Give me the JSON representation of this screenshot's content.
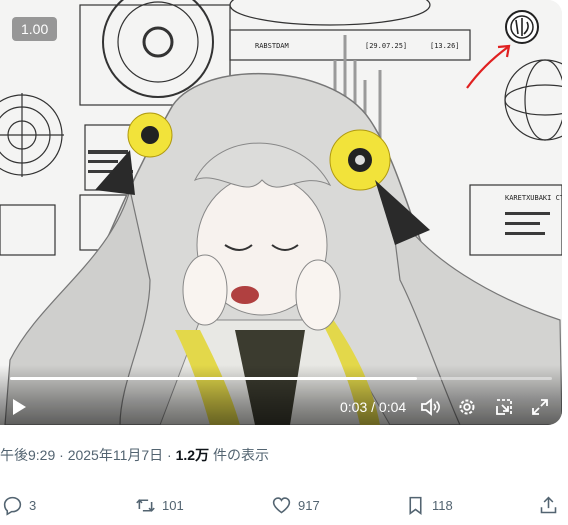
{
  "video": {
    "speed_badge": "1.00",
    "current_time": "0:03",
    "duration": "0:04",
    "time_separator": " / ",
    "progress": 0.75
  },
  "tweet_meta": {
    "time": "午後9:29",
    "date": "2025年11月7日",
    "separator": " · ",
    "views_count": "1.2万",
    "views_label": " 件の表示"
  },
  "actions": {
    "replies": "3",
    "reposts": "101",
    "likes": "917",
    "bookmarks": "118"
  }
}
